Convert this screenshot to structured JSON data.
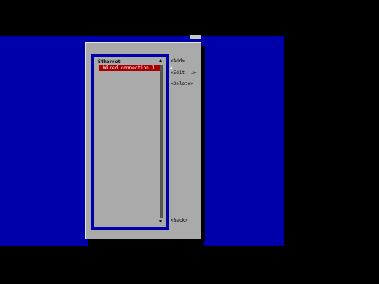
{
  "dialog": {
    "list": {
      "group_label": "Ethernet",
      "items": [
        {
          "label": "Wired connection 1",
          "selected": true
        }
      ],
      "scroll_up_glyph": "▲",
      "scroll_down_glyph": "▼"
    },
    "buttons": {
      "add": "<Add>",
      "edit": "<Edit...>",
      "delete": "<Delete>",
      "back": "<Back>"
    }
  },
  "colors": {
    "screen_background": "#0000aa",
    "dialog_background": "#aaaaaa",
    "selection": "#aa0000"
  },
  "icons": {
    "cursor": "mouse-pointer-icon"
  }
}
